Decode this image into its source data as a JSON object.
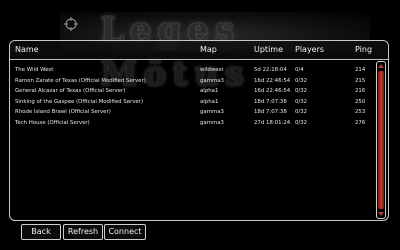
{
  "logo_text": "Leges Mōtus",
  "table": {
    "columns": {
      "name": "Name",
      "map": "Map",
      "uptime": "Uptime",
      "players": "Players",
      "ping": "Ping"
    },
    "rows": [
      {
        "name": "The Wild West",
        "map": "wildwest",
        "uptime": "5d 22:18:04",
        "players": "0/4",
        "ping": "214"
      },
      {
        "name": "Ramon Zarate of Texas (Official Modified Server)",
        "map": "gamma3",
        "uptime": "16d 22:46:54",
        "players": "0/32",
        "ping": "215"
      },
      {
        "name": "General Alcazar of Texas (Official Server)",
        "map": "alpha1",
        "uptime": "16d 22:46:54",
        "players": "0/32",
        "ping": "216"
      },
      {
        "name": "Sinking of the Gaspee (Official Modified Server)",
        "map": "alpha1",
        "uptime": "18d 7:07:38",
        "players": "0/32",
        "ping": "250"
      },
      {
        "name": "Rhode Island Brawl (Official Server)",
        "map": "gamma3",
        "uptime": "18d 7:07:38",
        "players": "0/32",
        "ping": "253"
      },
      {
        "name": "Tech House (Official Server)",
        "map": "gamma3",
        "uptime": "27d 18:01:24",
        "players": "0/32",
        "ping": "276"
      }
    ]
  },
  "buttons": {
    "back": "Back",
    "refresh": "Refresh",
    "connect": "Connect"
  },
  "colors": {
    "scrollbar_accent": "#c0392b",
    "panel_border": "#c8c8c8"
  }
}
